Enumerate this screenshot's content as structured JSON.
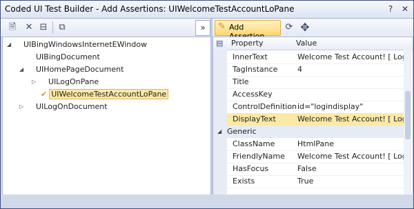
{
  "window": {
    "title": "Coded UI Test Builder - Add Assertions: UIWelcomeTestAccountLoPane"
  },
  "titlebar": {
    "help": "?",
    "close": "✕"
  },
  "left_toolbar": {
    "expand": "»"
  },
  "right_toolbar": {
    "add_assertion": "Add Assertion"
  },
  "tree": {
    "nodes": [
      {
        "label": "UIBingWindowsInternetEWindow"
      },
      {
        "label": "UIBingDocument"
      },
      {
        "label": "UIHomePageDocument"
      },
      {
        "label": "UILogOnPane"
      },
      {
        "label": "UIWelcomeTestAccountLoPane"
      },
      {
        "label": "UILogOnDocument"
      }
    ]
  },
  "grid": {
    "header": {
      "property": "Property",
      "value": "Value"
    },
    "rows": [
      {
        "name": "InnerText",
        "value": "Welcome Test Account! [ Log O"
      },
      {
        "name": "TagInstance",
        "value": "4"
      },
      {
        "name": "Title",
        "value": ""
      },
      {
        "name": "AccessKey",
        "value": ""
      },
      {
        "name": "ControlDefinition",
        "value": "id=\"logindisplay\""
      },
      {
        "name": "DisplayText",
        "value": "Welcome Test Account! [ Log O"
      }
    ],
    "category": {
      "label": "Generic"
    },
    "generic_rows": [
      {
        "name": "ClassName",
        "value": "HtmlPane"
      },
      {
        "name": "FriendlyName",
        "value": "Welcome Test Account! [ Log O"
      },
      {
        "name": "HasFocus",
        "value": "False"
      },
      {
        "name": "Exists",
        "value": "True"
      }
    ]
  }
}
